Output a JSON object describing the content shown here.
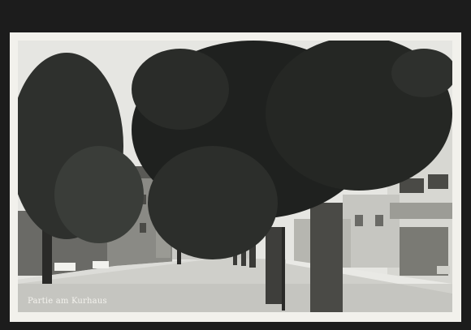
{
  "caption": "Partie am Kurhaus",
  "colors": {
    "frame": "#1c1c1c",
    "card_border": "#f2f1ec",
    "sky": "#e6e6e2",
    "foliage_dark": "#1f211f",
    "foliage_mid": "#3a3d39",
    "road": "#cfcfca",
    "sidewalk": "#e9e9e5",
    "building_left": "#6a6a66",
    "building_right": "#d7d7d2"
  }
}
